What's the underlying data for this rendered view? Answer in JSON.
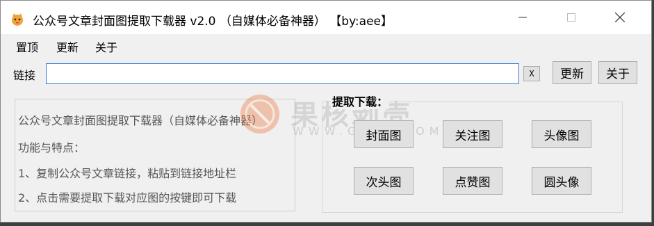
{
  "window": {
    "title": "公众号文章封面图提取下载器  v2.0  （自媒体必备神器）  【by:aee】"
  },
  "menu": {
    "items": [
      "置顶",
      "更新",
      "关于"
    ]
  },
  "link_row": {
    "label": "链接",
    "input_value": "",
    "input_placeholder": "",
    "clear_button": "X",
    "update_button": "更新",
    "about_button": "关于"
  },
  "description": {
    "lines": [
      "公众号文章封面图提取下载器（自媒体必备神器）",
      "功能与特点：",
      "1、复制公众号文章链接，粘贴到链接地址栏",
      "2、点击需要提取下载对应图的按键即可下载"
    ]
  },
  "download_group": {
    "title": "提取下载：",
    "buttons": [
      "封面图",
      "关注图",
      "头像图",
      "次头图",
      "点赞图",
      "圆头像"
    ]
  },
  "watermark": {
    "text": "果核剥壳",
    "subtext": "WWW.GHXI.COM"
  },
  "colors": {
    "input_border": "#3a7bd5",
    "window_bg": "#f0f0f0",
    "button_bg": "#e1e1e1",
    "watermark_orange": "#e8692a"
  },
  "icons": {
    "app": "app-cat-icon",
    "minimize": "minimize-icon",
    "maximize": "maximize-icon",
    "close": "close-icon"
  }
}
